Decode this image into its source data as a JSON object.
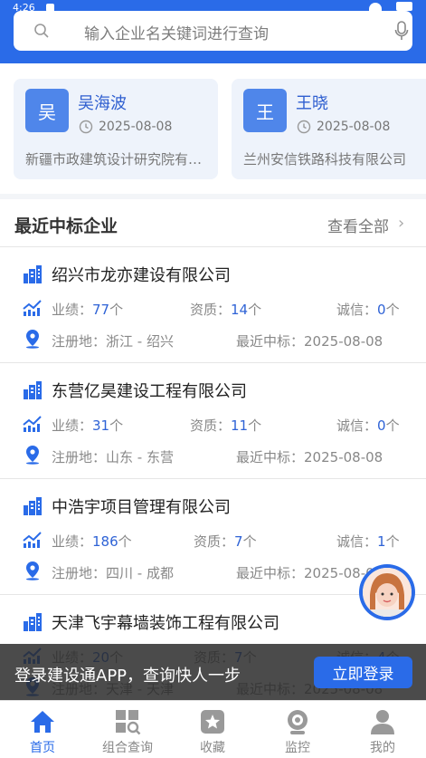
{
  "status_bar": {
    "time": "4:26"
  },
  "search": {
    "placeholder": "输入企业名关键词进行查询"
  },
  "recent_cards": [
    {
      "avatar_char": "吴",
      "name": "吴海波",
      "date": "2025-08-08",
      "company": "新疆市政建筑设计研究院有限公司"
    },
    {
      "avatar_char": "王",
      "name": "王晓",
      "date": "2025-08-08",
      "company": "兰州安信铁路科技有限公司"
    }
  ],
  "section": {
    "title": "最近中标企业",
    "more_label": "查看全部"
  },
  "labels": {
    "performance": "业绩：",
    "qualification": "资质：",
    "credit": "诚信：",
    "registered": "注册地：",
    "latest_bid": "最近中标：",
    "unit": "个"
  },
  "companies": [
    {
      "name": "绍兴市龙亦建设有限公司",
      "performance": "77",
      "qualification": "14",
      "credit": "0",
      "region": "浙江 - 绍兴",
      "latest": "2025-08-08"
    },
    {
      "name": "东营亿昊建设工程有限公司",
      "performance": "31",
      "qualification": "11",
      "credit": "0",
      "region": "山东 - 东营",
      "latest": "2025-08-08"
    },
    {
      "name": "中浩宇项目管理有限公司",
      "performance": "186",
      "qualification": "7",
      "credit": "1",
      "region": "四川 - 成都",
      "latest": "2025-08-08"
    },
    {
      "name": "天津飞宇幕墙装饰工程有限公司",
      "performance": "20",
      "qualification": "7",
      "credit": "4",
      "region": "天津 - 天津",
      "latest": "2025-08-08"
    }
  ],
  "banner": {
    "text": "登录建设通APP，查询快人一步",
    "button": "立即登录"
  },
  "tabs": [
    {
      "label": "首页",
      "icon": "home-icon",
      "active": true
    },
    {
      "label": "组合查询",
      "icon": "grid-search-icon",
      "active": false
    },
    {
      "label": "收藏",
      "icon": "star-icon",
      "active": false
    },
    {
      "label": "监控",
      "icon": "camera-icon",
      "active": false
    },
    {
      "label": "我的",
      "icon": "user-icon",
      "active": false
    }
  ],
  "colors": {
    "primary": "#2a6be8",
    "link": "#2f63d6"
  }
}
